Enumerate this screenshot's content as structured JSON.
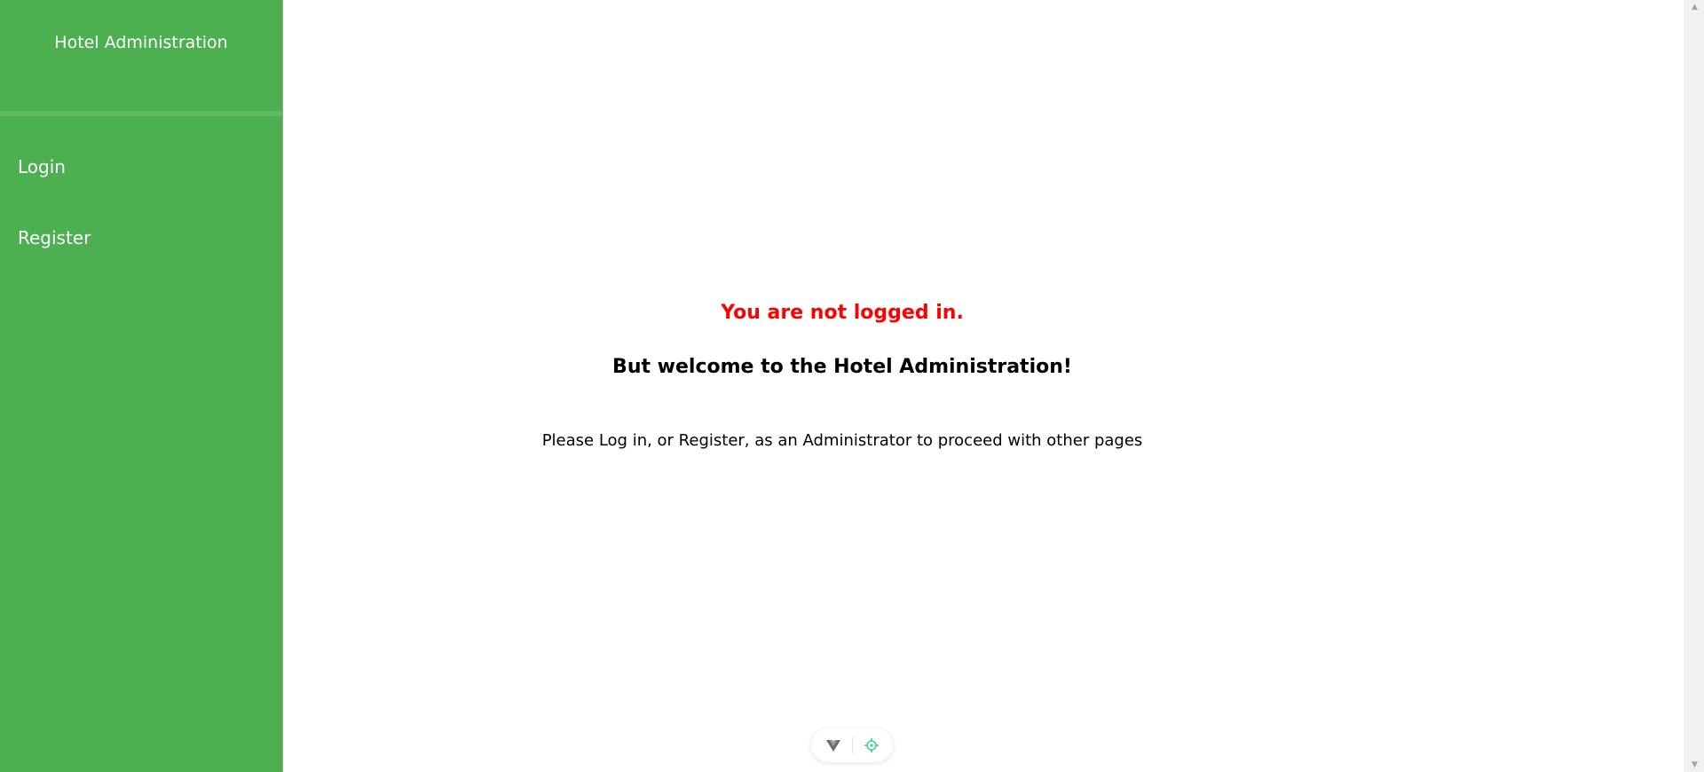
{
  "sidebar": {
    "title": "Hotel Administration",
    "items": [
      {
        "label": "Login"
      },
      {
        "label": "Register"
      }
    ]
  },
  "main": {
    "status_message": "You are not logged in.",
    "welcome_message": "But welcome to the Hotel Administration!",
    "instructions": "Please Log in, or Register, as an Administrator to proceed with other pages"
  },
  "devtools": {
    "icons": [
      "vue-logo-icon",
      "crosshair-icon"
    ]
  },
  "colors": {
    "sidebar_bg": "#4caf50",
    "status_red": "#ff0000",
    "devtools_accent": "#42d392"
  }
}
